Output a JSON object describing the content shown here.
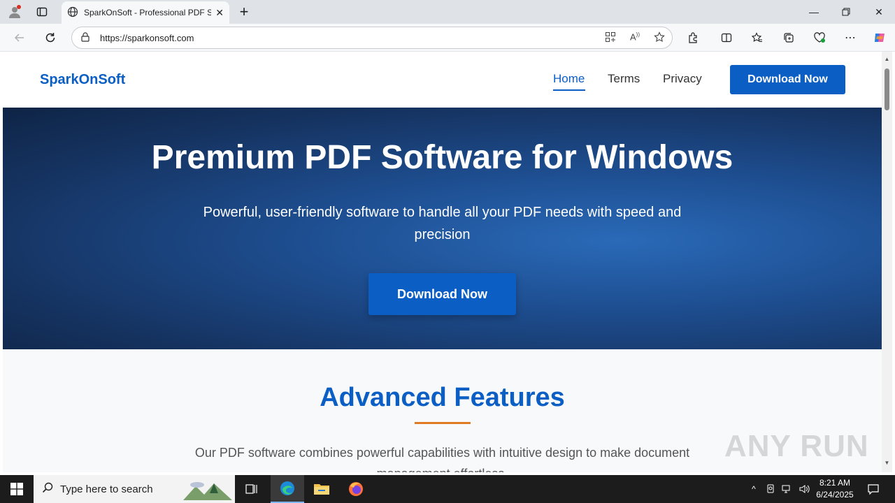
{
  "browser": {
    "tab_title": "SparkOnSoft - Professional PDF S",
    "url": "https://sparkonsoft.com",
    "icons": [
      "profile-icon",
      "tab-actions-icon",
      "globe-icon",
      "close-tab-icon",
      "new-tab-icon",
      "back-icon",
      "refresh-icon",
      "site-info-icon",
      "app-available-icon",
      "read-aloud-icon",
      "favorite-star-icon",
      "extensions-icon",
      "split-screen-icon",
      "favorites-icon",
      "collections-icon",
      "browser-essentials-icon",
      "more-icon",
      "copilot-icon"
    ]
  },
  "site": {
    "logo": "SparkOnSoft",
    "nav": {
      "home": "Home",
      "terms": "Terms",
      "privacy": "Privacy"
    },
    "header_download": "Download Now",
    "hero": {
      "title": "Premium PDF Software for Windows",
      "subtitle": "Powerful, user-friendly software to handle all your PDF needs with speed and precision",
      "download": "Download Now"
    },
    "features": {
      "title": "Advanced Features",
      "description": "Our PDF software combines powerful capabilities with intuitive design to make document management effortless."
    },
    "watermark": "ANY RUN"
  },
  "taskbar": {
    "search_placeholder": "Type here to search",
    "time": "8:21 AM",
    "date": "6/24/2025"
  },
  "colors": {
    "brand": "#0b5fc4",
    "accent_line": "#e07b24"
  }
}
